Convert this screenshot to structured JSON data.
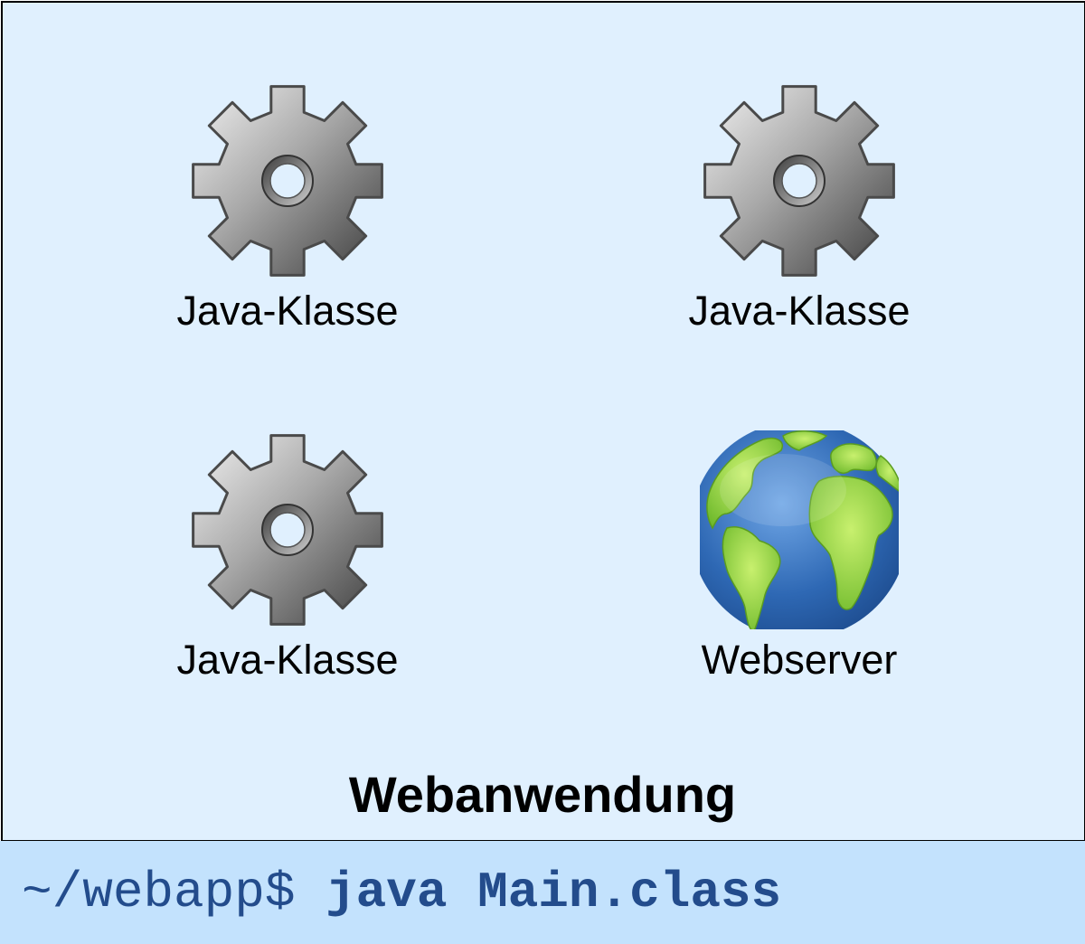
{
  "diagram": {
    "container": {
      "title": "Webanwendung",
      "background": "#e0f0fe",
      "border": "#000000"
    },
    "components": [
      {
        "icon": "gear-icon",
        "label": "Java-Klasse"
      },
      {
        "icon": "gear-icon",
        "label": "Java-Klasse"
      },
      {
        "icon": "gear-icon",
        "label": "Java-Klasse"
      },
      {
        "icon": "globe-icon",
        "label": "Webserver"
      }
    ]
  },
  "terminal": {
    "prompt": "~/webapp$ ",
    "command": "java Main.class",
    "background": "#c3e2fd",
    "text_color": "#234c8c"
  }
}
